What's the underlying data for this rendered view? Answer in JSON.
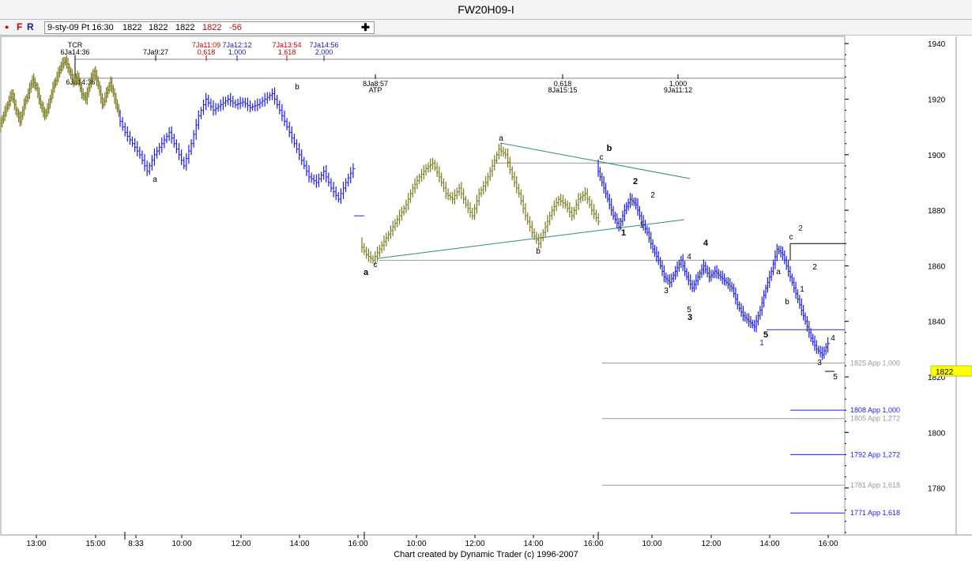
{
  "window": {
    "title": "FW20H09-I"
  },
  "toolbar": {
    "dot_label": "●",
    "f_label": "F",
    "r_label": "R",
    "info": {
      "date_time": "9-sty-09 Pt 16:30",
      "open": "1822",
      "high": "1822",
      "low": "1822",
      "close": "1822",
      "change": "-56"
    },
    "crosshair_label": "✚"
  },
  "footer": {
    "credit": "Chart created by Dynamic Trader  (c) 1996-2007"
  },
  "chart_data": {
    "type": "bar",
    "symbol": "FW20H09-I",
    "last_price": 1822,
    "ylim": [
      1762,
      1944
    ],
    "y_ticks": [
      1780,
      1800,
      1820,
      1840,
      1860,
      1880,
      1900,
      1920,
      1940
    ],
    "x_tick_labels": [
      "13:00",
      "15:00",
      "8:33",
      "10:00",
      "12:00",
      "14:00",
      "16:00",
      "10:00",
      "12:00",
      "14:00",
      "16:00",
      "10:00",
      "12:00",
      "14:00",
      "16:00"
    ],
    "series": [
      {
        "color": "#7a7a1e",
        "segments": [
          {
            "x_start": 1,
            "x_end": 152,
            "closes": [
              1910,
              1914,
              1918,
              1922,
              1916,
              1912,
              1918,
              1922,
              1927,
              1924,
              1918,
              1914,
              1918,
              1924,
              1928,
              1932,
              1934,
              1930,
              1926,
              1928,
              1922,
              1920,
              1926,
              1930,
              1925,
              1918,
              1922,
              1926,
              1920,
              1915
            ]
          },
          {
            "x_start": 458,
            "x_end": 760,
            "closes": [
              1868,
              1864,
              1862,
              1866,
              1870,
              1874,
              1878,
              1882,
              1888,
              1892,
              1895,
              1897,
              1892,
              1886,
              1884,
              1888,
              1882,
              1878,
              1886,
              1890,
              1896,
              1902,
              1900,
              1892,
              1886,
              1878,
              1872,
              1868,
              1874,
              1880,
              1884,
              1882,
              1878,
              1884,
              1886,
              1880,
              1876
            ]
          }
        ]
      },
      {
        "color": "#1a1aff",
        "segments": [
          {
            "x_start": 152,
            "x_end": 450,
            "closes": [
              1914,
              1908,
              1904,
              1900,
              1894,
              1900,
              1904,
              1908,
              1902,
              1896,
              1904,
              1914,
              1920,
              1916,
              1918,
              1920,
              1918,
              1919,
              1917,
              1918,
              1920,
              1922,
              1916,
              1910,
              1904,
              1898,
              1892,
              1890,
              1894,
              1888,
              1884,
              1890,
              1895
            ]
          },
          {
            "x_start": 757,
            "x_end": 1050,
            "closes": [
              1896,
              1890,
              1884,
              1878,
              1874,
              1880,
              1884,
              1882,
              1876,
              1872,
              1866,
              1862,
              1856,
              1854,
              1858,
              1862,
              1856,
              1852,
              1856,
              1860,
              1856,
              1858,
              1856,
              1854,
              1852,
              1846,
              1842,
              1840,
              1838,
              1844,
              1852,
              1858,
              1866,
              1864,
              1858,
              1852,
              1846,
              1840,
              1834,
              1830,
              1828,
              1832
            ]
          }
        ]
      }
    ],
    "horizontal_levels": [
      {
        "value": 1897,
        "label": "",
        "color": "#999999"
      },
      {
        "value": 1862,
        "label": "",
        "color": "#999999"
      },
      {
        "value": 1868,
        "label": "",
        "color": "#000000"
      },
      {
        "value": 1837,
        "label": "",
        "color": "#2a2acc"
      },
      {
        "value": 1825,
        "label": "1825 App 1,000",
        "color": "#999999"
      },
      {
        "value": 1808,
        "label": "1808 App 1,000",
        "color": "#1a1aff"
      },
      {
        "value": 1805,
        "label": "1805 App 1,272",
        "color": "#999999"
      },
      {
        "value": 1792,
        "label": "1792 App 1,272",
        "color": "#1a1aff"
      },
      {
        "value": 1781,
        "label": "1781 App 1,618",
        "color": "#999999"
      },
      {
        "value": 1771,
        "label": "1771 App 1,618",
        "color": "#1a1aff"
      }
    ],
    "time_rulers": [
      {
        "labels": [
          {
            "top": "TCR",
            "bottom": "6Ja14:36",
            "color": "#000000"
          },
          {
            "top": "",
            "bottom": "7Ja9:27",
            "color": "#000000"
          },
          {
            "top": "7Ja11:09",
            "bottom": "0,618",
            "color": "#cc0000"
          },
          {
            "top": "7Ja12:12",
            "bottom": "1,000",
            "color": "#1a1acc"
          },
          {
            "top": "7Ja13:54",
            "bottom": "1,618",
            "color": "#cc0000"
          },
          {
            "top": "7Ja14:56",
            "bottom": "2,000",
            "color": "#1a1acc"
          }
        ]
      },
      {
        "labels": [
          {
            "top": "6Ja14:36",
            "bottom": "",
            "color": "#000000"
          },
          {
            "top": "8Ja8:57",
            "bottom": "ATP",
            "color": "#000000"
          },
          {
            "top": "0,618",
            "bottom": "8Ja15:15",
            "color": "#000000"
          },
          {
            "top": "1,000",
            "bottom": "9Ja11:12",
            "color": "#000000"
          }
        ]
      }
    ],
    "trend_lines": [
      {
        "from": [
          1903,
          1872
        ],
        "to": [
          1862,
          1876
        ]
      }
    ],
    "annotations": [
      {
        "text": "a",
        "color": "#000000",
        "bold": false
      },
      {
        "text": "b",
        "color": "#000000",
        "bold": false
      },
      {
        "text": "c",
        "color": "#000000",
        "bold": false
      },
      {
        "text": "a",
        "color": "#000000",
        "bold": true
      },
      {
        "text": "a",
        "color": "#000000",
        "bold": false
      },
      {
        "text": "b",
        "color": "#000000",
        "bold": false
      },
      {
        "text": "c",
        "color": "#000000",
        "bold": false
      },
      {
        "text": "b",
        "color": "#000000",
        "bold": true
      },
      {
        "text": "1",
        "color": "#000000",
        "bold": true
      },
      {
        "text": "2",
        "color": "#000000",
        "bold": true
      },
      {
        "text": "1",
        "color": "#000000",
        "bold": false
      },
      {
        "text": "2",
        "color": "#000000",
        "bold": false
      },
      {
        "text": "3",
        "color": "#000000",
        "bold": false
      },
      {
        "text": "4",
        "color": "#000000",
        "bold": false
      },
      {
        "text": "5",
        "color": "#000000",
        "bold": false
      },
      {
        "text": "3",
        "color": "#000000",
        "bold": true
      },
      {
        "text": "4",
        "color": "#000000",
        "bold": true
      },
      {
        "text": "a",
        "color": "#000000",
        "bold": false
      },
      {
        "text": "b",
        "color": "#000000",
        "bold": false
      },
      {
        "text": "c",
        "color": "#000000",
        "bold": false
      },
      {
        "text": "5",
        "color": "#000000",
        "bold": true
      },
      {
        "text": "1",
        "color": "#1a1acc",
        "bold": false
      },
      {
        "text": "2",
        "color": "#1a1acc",
        "bold": false
      },
      {
        "text": "1",
        "color": "#000000",
        "bold": false
      },
      {
        "text": "2",
        "color": "#000000",
        "bold": false
      },
      {
        "text": "3",
        "color": "#000000",
        "bold": false
      },
      {
        "text": "4",
        "color": "#000000",
        "bold": false
      },
      {
        "text": "5",
        "color": "#000000",
        "bold": false
      }
    ]
  }
}
